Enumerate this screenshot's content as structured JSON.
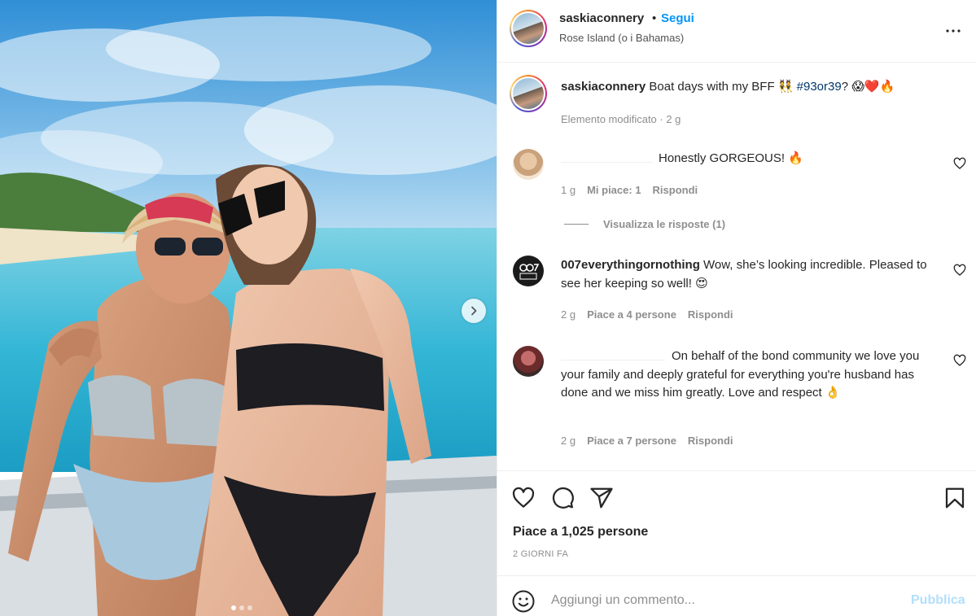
{
  "post": {
    "username": "saskiaconnery",
    "dot": "•",
    "follow": "Segui",
    "location": "Rose Island (o i Bahamas)",
    "caption": {
      "username": "saskiaconnery",
      "text": "Boat days with my BFF 👯",
      "hashtag": "#93or39",
      "after": "? 😱❤️🔥",
      "meta": "Elemento modificato · 2 g"
    },
    "comments": [
      {
        "username": "",
        "text": "Honestly GORGEOUS! 🔥",
        "time": "1 g",
        "likes": "Mi piace: 1",
        "reply": "Rispondi",
        "view_replies": "Visualizza le risposte (1)"
      },
      {
        "username": "007everythingornothing",
        "text": "Wow, she’s looking incredible. Pleased to see her keeping so well! 😍",
        "time": "2 g",
        "likes": "Piace a 4 persone",
        "reply": "Rispondi"
      },
      {
        "username": "",
        "text": "On behalf of the bond community we love you your family and deeply grateful for everything you're husband has done and we miss him greatly. Love and respect 👌",
        "time": "2 g",
        "likes": "Piace a 7 persone",
        "reply": "Rispondi"
      }
    ],
    "likes": "Piace a 1,025 persone",
    "time_ago": "2 GIORNI FA",
    "add_comment": {
      "placeholder": "Aggiungi un commento...",
      "publish": "Pubblica"
    },
    "carousel": {
      "slides": 3,
      "current": 1
    }
  },
  "icons": [
    "more-icon",
    "heart-icon",
    "comment-icon",
    "share-icon",
    "save-icon",
    "emoji-icon",
    "next-arrow-icon"
  ],
  "colors": {
    "link": "#0095f6",
    "hashtag": "#00376b",
    "muted": "#8e8e8e",
    "publish_disabled": "#b2dffc"
  }
}
